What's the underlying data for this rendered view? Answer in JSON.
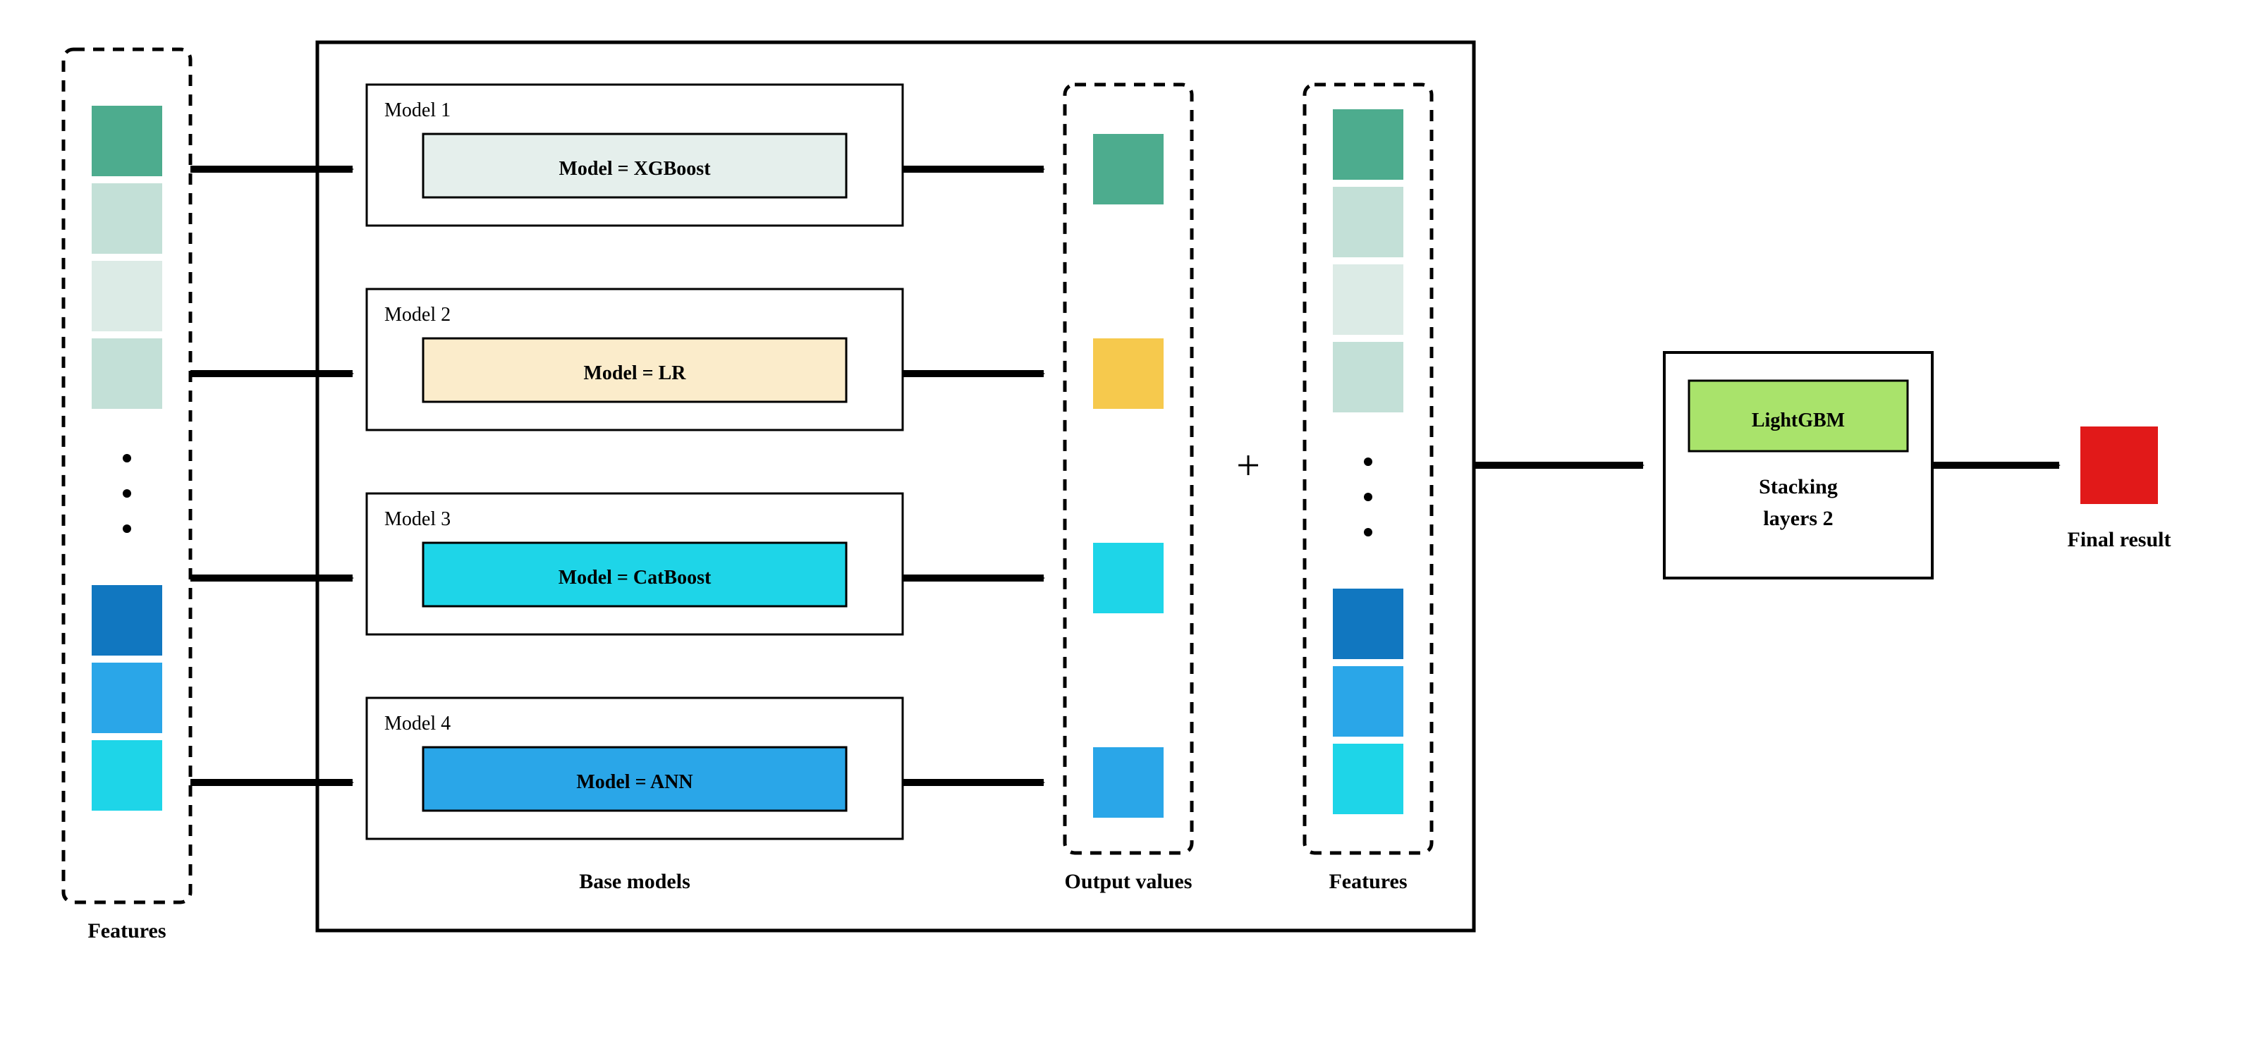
{
  "features_left_label": "Features",
  "base_models_label": "Base models",
  "output_values_label": "Output values",
  "features_right_label": "Features",
  "plus_symbol": "+",
  "stacking_model": "LightGBM",
  "stacking_label_line1": "Stacking",
  "stacking_label_line2": "layers 2",
  "final_result_label": "Final result",
  "models": [
    {
      "title": "Model 1",
      "text": "Model = XGBoost",
      "fill": "#e5efec",
      "stroke": "#000000",
      "out_fill": "#4dac8e"
    },
    {
      "title": "Model 2",
      "text": "Model =  LR",
      "fill": "#fbeccb",
      "stroke": "#000000",
      "out_fill": "#f6c94d"
    },
    {
      "title": "Model 3",
      "text": "Model = CatBoost",
      "fill": "#1ed5e8",
      "stroke": "#000000",
      "out_fill": "#1ed5e8"
    },
    {
      "title": "Model 4",
      "text": "Model = ANN",
      "fill": "#2aa6e8",
      "stroke": "#000000",
      "out_fill": "#2aa6e8"
    }
  ],
  "left_features_colors": [
    "#4dac8e",
    "#c3e0d7",
    "#dcebe6",
    "#c3e0d7",
    "#1177c0",
    "#2aa6e8",
    "#1ed5e8"
  ],
  "right_features_colors": [
    "#4dac8e",
    "#c3e0d7",
    "#dcebe6",
    "#c3e0d7",
    "#1177c0",
    "#2aa6e8",
    "#1ed5e8"
  ],
  "final_color": "#e11919",
  "stacking_fill": "#a9e36b"
}
